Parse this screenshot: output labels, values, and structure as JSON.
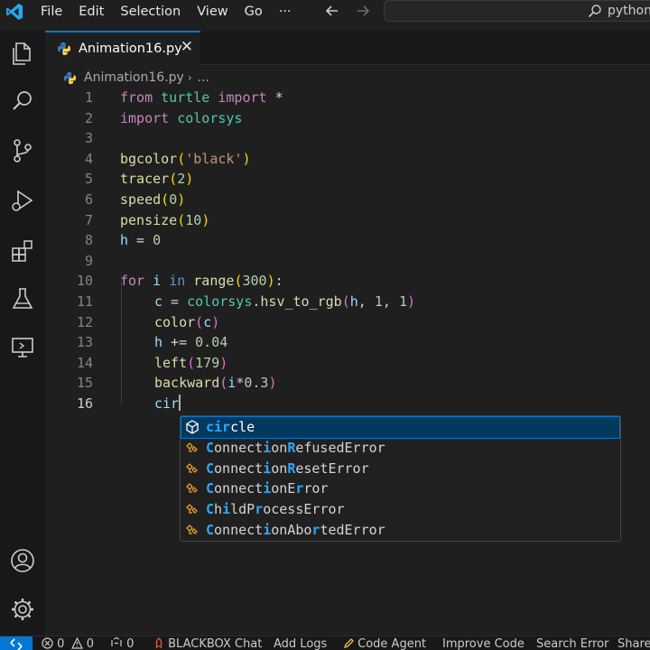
{
  "menu": [
    "File",
    "Edit",
    "Selection",
    "View",
    "Go",
    "···"
  ],
  "command_center": {
    "text": "python"
  },
  "tab": {
    "label": "Animation16.py",
    "close": "✕"
  },
  "breadcrumb": {
    "file": "Animation16.py",
    "sep": "›",
    "rest": "..."
  },
  "editor": {
    "line_numbers": [
      "1",
      "2",
      "3",
      "4",
      "5",
      "6",
      "7",
      "8",
      "9",
      "10",
      "11",
      "12",
      "13",
      "14",
      "15",
      "16"
    ],
    "lines": [
      {
        "k1": "from",
        "mod": "turtle",
        "k2": "import",
        "star": " *"
      },
      {
        "k1": "import",
        "mod": "colorsys"
      },
      {},
      {
        "fn": "bgcolor",
        "lp": "(",
        "arg": "'black'",
        "rp": ")"
      },
      {
        "fn": "tracer",
        "lp": "(",
        "arg": "2",
        "rp": ")"
      },
      {
        "fn": "speed",
        "lp": "(",
        "arg": "0",
        "rp": ")"
      },
      {
        "fn": "pensize",
        "lp": "(",
        "arg": "10",
        "rp": ")"
      },
      {
        "var": "h",
        "op": " = ",
        "num": "0"
      },
      {},
      {
        "kw": "for",
        "var": "i",
        "kw2": "in",
        "fn": "range",
        "lp": "(",
        "num": "300",
        "rp": ")",
        "colon": ":"
      },
      {
        "var": "c",
        "op": " = ",
        "mod": "colorsys",
        "dot": ".",
        "fn": "hsv_to_rgb",
        "lp": "(",
        "a1": "h",
        "c1": ", ",
        "a2": "1",
        "c2": ", ",
        "a3": "1",
        "rp": ")"
      },
      {
        "fn": "color",
        "lp": "(",
        "arg": "c",
        "rp": ")"
      },
      {
        "var": "h",
        "op": " += ",
        "num": "0.04"
      },
      {
        "fn": "left",
        "lp": "(",
        "arg": "179",
        "rp": ")"
      },
      {
        "fn": "backward",
        "lp": "(",
        "a1": "i",
        "op": "*",
        "a2": "0.3",
        "rp": ")"
      },
      {
        "typed": "cir"
      }
    ]
  },
  "suggestions": [
    {
      "pre": "",
      "h1": "cir",
      "mid": "",
      "h2": "",
      "post": "cle",
      "full": "circle",
      "kind": "function"
    },
    {
      "full": "ConnectionRefusedError",
      "kind": "class"
    },
    {
      "full": "ConnectionResetError",
      "kind": "class"
    },
    {
      "full": "ConnectionError",
      "kind": "class"
    },
    {
      "full": "ChildProcessError",
      "kind": "class"
    },
    {
      "full": "ConnectionAbortedError",
      "kind": "class"
    }
  ],
  "statusbar": {
    "errors": "0",
    "warnings": "0",
    "ports": "0",
    "blackbox": "BLACKBOX Chat",
    "add_logs": "Add Logs",
    "code_agent": "Code Agent",
    "improve_code": "Improve Code",
    "search_error": "Search Error",
    "share": "Share"
  },
  "colors": {
    "accent": "#0078d4",
    "background": "#1f1f1f",
    "highlight": "#2aaaff"
  }
}
